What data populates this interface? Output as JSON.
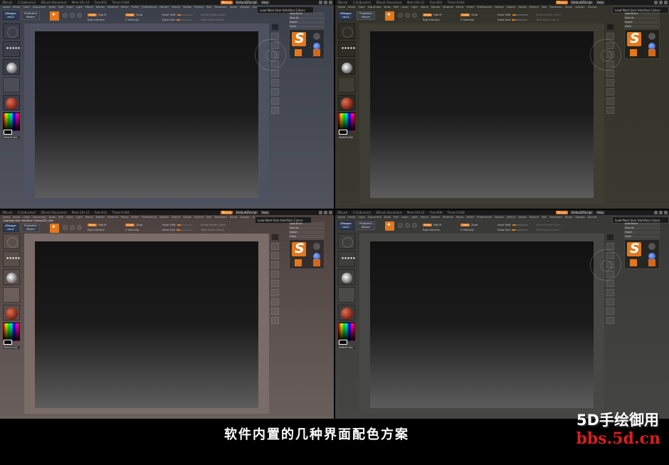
{
  "titlebar": {
    "app": "ZBrush",
    "version": "3.1[zbrushn]",
    "doc": "ZBrush Document",
    "mem_prefix": "Mem:",
    "free_prefix": "Free:",
    "timer_prefix": "Timer:",
    "buttons": [
      "Menus",
      "DefaultZScript",
      "Help"
    ]
  },
  "menubar": [
    "Alpha",
    "Brush",
    "Color",
    "Document",
    "Draw",
    "Edit",
    "Layer",
    "Light",
    "Macro",
    "Marker",
    "Material",
    "Movie",
    "Picker",
    "Preferences",
    "Render",
    "Stencil",
    "Stroke",
    "Texture",
    "Tool",
    "Transform",
    "Zoom",
    "Zplugin",
    "Zscript"
  ],
  "toolbar": {
    "zmapper": "ZMapper",
    "zmapper_sub": "rev-E",
    "projection": "Projection",
    "master": "Master",
    "zadd": "Zadd",
    "zsub": "Zsub",
    "mrgb": "Mrgb",
    "rgb": "Rgb",
    "m": "M",
    "intensity": "Rgb Intensity",
    "z_intensity": "Z Intensity",
    "focal_shift": "Focal Shift",
    "draw_size": "Draw Size",
    "active_points": "Active Points Count",
    "total_points": "Total Points Count"
  },
  "panes": [
    {
      "tooltip": "Load Next User Interface Colors",
      "mem": "Mem:19+12",
      "free": "Free:612",
      "timer": "Timer:0.004"
    },
    {
      "tooltip": "Load Next User Interface Colors",
      "mem": "Mem:18+12",
      "free": "Free:624",
      "timer": "Timer:0.004"
    },
    {
      "tooltip": "Load Next User Interface Colors",
      "notice": "Loading User Interface Colors(ZS2_file)",
      "mem": "Mem:19+12",
      "free": "Free:612",
      "timer": "Timer:0.004"
    },
    {
      "tooltip": "Load Next User Interface Colors",
      "mem": "Mem:19+12",
      "free": "Free:606",
      "timer": "Timer:0.004"
    }
  ],
  "left": {
    "switch_color": "SwitchColor"
  },
  "brushpanel": {
    "rows": [
      "Load Brush",
      "Save As",
      "Import",
      "Clone"
    ],
    "brush_name": "SimpleBrush"
  },
  "caption": "软件内置的几种界面配色方案",
  "brand": {
    "name": "5D手绘御用",
    "url": "bbs.5d.cn"
  },
  "colors": {
    "accent": "#e2781b",
    "theme_blue": "#3a3d47",
    "theme_olive": "#35352c",
    "theme_brown": "#4a3f3d",
    "theme_gray": "#3a3a38",
    "caption_text": "#ffffff",
    "brand_red": "#d81e1e"
  }
}
